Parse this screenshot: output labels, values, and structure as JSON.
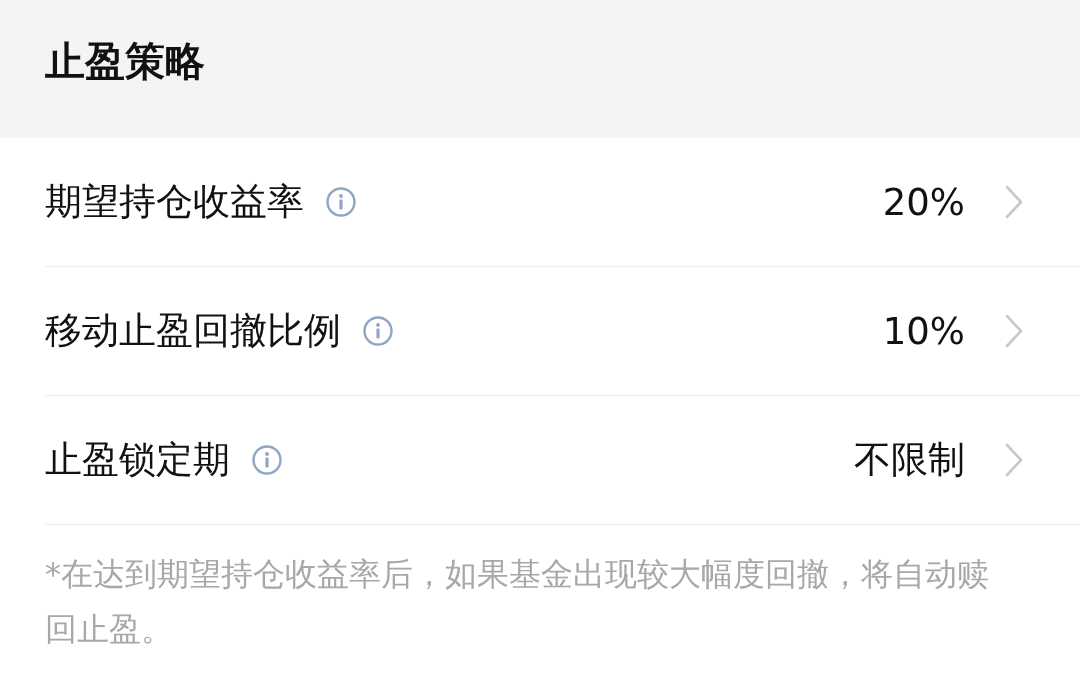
{
  "header": {
    "title": "止盈策略"
  },
  "settings": [
    {
      "label": "期望持仓收益率",
      "value": "20%"
    },
    {
      "label": "移动止盈回撤比例",
      "value": "10%"
    },
    {
      "label": "止盈锁定期",
      "value": "不限制"
    }
  ],
  "note": "*在达到期望持仓收益率后，如果基金出现较大幅度回撤，将自动赎回止盈。"
}
